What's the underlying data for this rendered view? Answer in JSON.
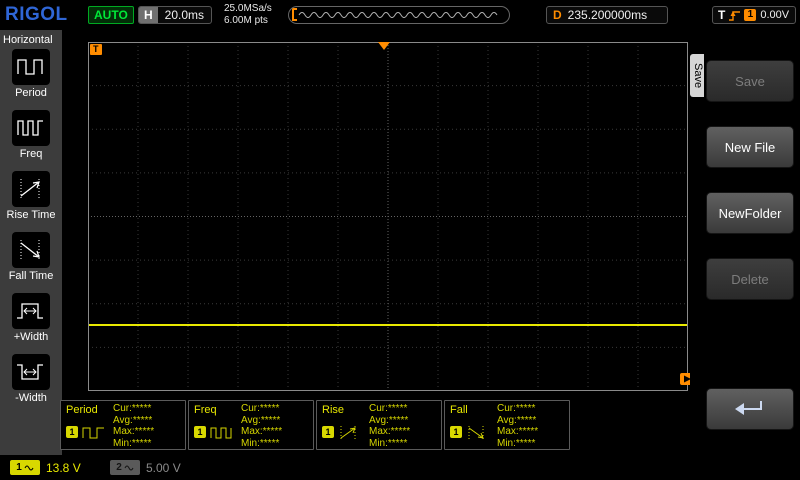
{
  "top_bar": {
    "logo": "RIGOL",
    "mode_badge": "AUTO",
    "horizontal": {
      "label": "H",
      "timebase": "20.0ms"
    },
    "acquisition": {
      "sample_rate": "25.0MSa/s",
      "memory_depth": "6.00M pts"
    },
    "delay": {
      "label": "D",
      "value": "235.200000ms"
    },
    "trigger": {
      "label": "T",
      "source": "1",
      "level": "0.00V"
    }
  },
  "left_menu": {
    "title": "Horizontal",
    "items": [
      {
        "label": "Period"
      },
      {
        "label": "Freq"
      },
      {
        "label": "Rise Time"
      },
      {
        "label": "Fall Time"
      },
      {
        "label": "+Width"
      },
      {
        "label": "-Width"
      }
    ]
  },
  "graticule": {
    "trigger_flag": "T"
  },
  "measurements": [
    {
      "name": "Period",
      "source": "1",
      "cur": "Cur:*****",
      "avg": "Avg:*****",
      "max": "Max:*****",
      "min": "Min:*****"
    },
    {
      "name": "Freq",
      "source": "1",
      "cur": "Cur:*****",
      "avg": "Avg:*****",
      "max": "Max:*****",
      "min": "Min:*****"
    },
    {
      "name": "Rise",
      "source": "1",
      "cur": "Cur:*****",
      "avg": "Avg:*****",
      "max": "Max:*****",
      "min": "Min:*****"
    },
    {
      "name": "Fall",
      "source": "1",
      "cur": "Cur:*****",
      "avg": "Avg:*****",
      "max": "Max:*****",
      "min": "Min:*****"
    }
  ],
  "right_menu": {
    "tab_title": "Save",
    "buttons": [
      {
        "label": "Save",
        "enabled": false
      },
      {
        "label": "New File",
        "enabled": true
      },
      {
        "label": "NewFolder",
        "enabled": true
      },
      {
        "label": "Delete",
        "enabled": false
      }
    ]
  },
  "status_bar": {
    "channels": [
      {
        "number": "1",
        "scale": "13.8 V",
        "active": true
      },
      {
        "number": "2",
        "scale": "5.00 V",
        "active": false
      }
    ]
  },
  "colors": {
    "channel1_yellow": "#e8e800",
    "trigger_orange": "#ff8c00",
    "auto_green": "#00e838",
    "logo_blue": "#2f66d6"
  }
}
